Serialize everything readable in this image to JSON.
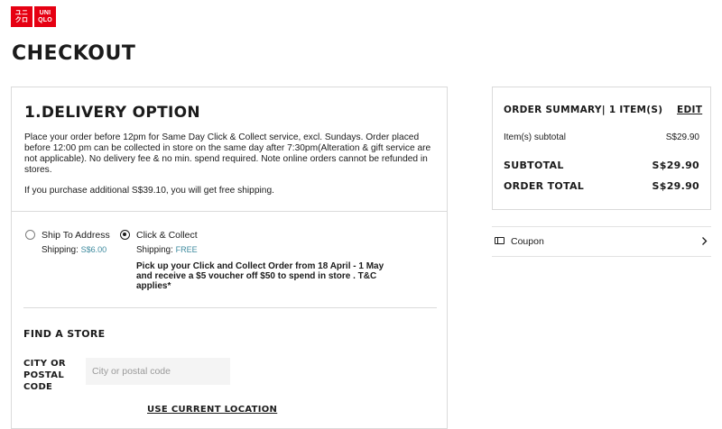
{
  "logo": {
    "left_text": "ユニ\nクロ",
    "right_text": "UNI\nQLO"
  },
  "page": {
    "title": "CHECKOUT"
  },
  "delivery": {
    "section_title": "1.DELIVERY OPTION",
    "info": "Place your order before 12pm for Same Day Click & Collect service, excl. Sundays. Order placed before 12:00 pm can be collected in store on the same day after 7:30pm(Alteration & gift service are not applicable). No delivery fee & no min. spend required. Note online orders cannot be refunded in stores.",
    "free_shipping_note": "If you purchase additional S$39.10, you will get free shipping.",
    "options": [
      {
        "label": "Ship To Address",
        "shipping_prefix": "Shipping: ",
        "shipping_value": "S$6.00",
        "selected": false
      },
      {
        "label": "Click & Collect",
        "shipping_prefix": "Shipping: ",
        "shipping_value": "FREE",
        "selected": true
      }
    ],
    "promo": "Pick up your Click and Collect Order from 18 April - 1 May and receive a $5 voucher off $50 to spend in store . T&C applies*"
  },
  "find_store": {
    "title": "FIND A STORE",
    "city_label": "CITY OR POSTAL CODE",
    "city_value": "",
    "city_placeholder": "City or postal code",
    "use_location": "USE CURRENT LOCATION"
  },
  "summary": {
    "title": "ORDER SUMMARY| 1 ITEM(S)",
    "edit": "EDIT",
    "item_subtotal_label": "Item(s) subtotal",
    "item_subtotal_value": "S$29.90",
    "subtotal_label": "SUBTOTAL",
    "subtotal_value": "S$29.90",
    "order_total_label": "ORDER TOTAL",
    "order_total_value": "S$29.90"
  },
  "coupon": {
    "label": "Coupon",
    "icon": "coupon-icon"
  },
  "colors": {
    "brand": "#e60012",
    "price_accent": "#3d8a9e",
    "border": "#dadada"
  }
}
